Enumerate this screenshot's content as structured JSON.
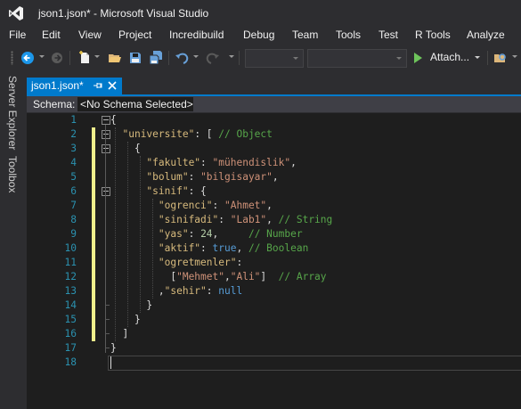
{
  "window": {
    "title": "json1.json* - Microsoft Visual Studio"
  },
  "menu": [
    "File",
    "Edit",
    "View",
    "Project",
    "Incredibuild",
    "Debug",
    "Team",
    "Tools",
    "Test",
    "R Tools",
    "Analyze"
  ],
  "toolbar": {
    "attach_label": "Attach...",
    "icons": [
      "back-icon",
      "forward-icon",
      "new-project-icon",
      "open-file-icon",
      "save-icon",
      "save-all-icon",
      "undo-icon",
      "redo-icon",
      "start-icon",
      "find-icon"
    ]
  },
  "side_panels": [
    "Server Explorer",
    "Toolbox"
  ],
  "tab": {
    "label": "json1.json*"
  },
  "schema": {
    "label": "Schema:",
    "value": "<No Schema Selected>"
  },
  "editor": {
    "lines": [
      [
        {
          "t": "{",
          "c": "punc"
        }
      ],
      [
        {
          "t": "  ",
          "c": "punc"
        },
        {
          "t": "\"universite\"",
          "c": "key"
        },
        {
          "t": ": [ ",
          "c": "punc"
        },
        {
          "t": "// Object",
          "c": "com"
        }
      ],
      [
        {
          "t": "    {",
          "c": "punc"
        }
      ],
      [
        {
          "t": "      ",
          "c": "punc"
        },
        {
          "t": "\"fakulte\"",
          "c": "key"
        },
        {
          "t": ": ",
          "c": "punc"
        },
        {
          "t": "\"mühendislik\"",
          "c": "str"
        },
        {
          "t": ",",
          "c": "punc"
        }
      ],
      [
        {
          "t": "      ",
          "c": "punc"
        },
        {
          "t": "\"bolum\"",
          "c": "key"
        },
        {
          "t": ": ",
          "c": "punc"
        },
        {
          "t": "\"bilgisayar\"",
          "c": "str"
        },
        {
          "t": ",",
          "c": "punc"
        }
      ],
      [
        {
          "t": "      ",
          "c": "punc"
        },
        {
          "t": "\"sinif\"",
          "c": "key"
        },
        {
          "t": ": {",
          "c": "punc"
        }
      ],
      [
        {
          "t": "        ",
          "c": "punc"
        },
        {
          "t": "\"ogrenci\"",
          "c": "key"
        },
        {
          "t": ": ",
          "c": "punc"
        },
        {
          "t": "\"Ahmet\"",
          "c": "str"
        },
        {
          "t": ",",
          "c": "punc"
        }
      ],
      [
        {
          "t": "        ",
          "c": "punc"
        },
        {
          "t": "\"sinifadi\"",
          "c": "key"
        },
        {
          "t": ": ",
          "c": "punc"
        },
        {
          "t": "\"Lab1\"",
          "c": "str"
        },
        {
          "t": ", ",
          "c": "punc"
        },
        {
          "t": "// String",
          "c": "com"
        }
      ],
      [
        {
          "t": "        ",
          "c": "punc"
        },
        {
          "t": "\"yas\"",
          "c": "key"
        },
        {
          "t": ": ",
          "c": "punc"
        },
        {
          "t": "24",
          "c": "num"
        },
        {
          "t": ",     ",
          "c": "punc"
        },
        {
          "t": "// Number",
          "c": "com"
        }
      ],
      [
        {
          "t": "        ",
          "c": "punc"
        },
        {
          "t": "\"aktif\"",
          "c": "key"
        },
        {
          "t": ": ",
          "c": "punc"
        },
        {
          "t": "true",
          "c": "kw"
        },
        {
          "t": ", ",
          "c": "punc"
        },
        {
          "t": "// Boolean",
          "c": "com"
        }
      ],
      [
        {
          "t": "        ",
          "c": "punc"
        },
        {
          "t": "\"ogretmenler\"",
          "c": "key"
        },
        {
          "t": ":",
          "c": "punc"
        }
      ],
      [
        {
          "t": "          [",
          "c": "punc"
        },
        {
          "t": "\"Mehmet\"",
          "c": "str"
        },
        {
          "t": ",",
          "c": "punc"
        },
        {
          "t": "\"Ali\"",
          "c": "str"
        },
        {
          "t": "]  ",
          "c": "punc"
        },
        {
          "t": "// Array",
          "c": "com"
        }
      ],
      [
        {
          "t": "        ,",
          "c": "punc"
        },
        {
          "t": "\"sehir\"",
          "c": "key"
        },
        {
          "t": ": ",
          "c": "punc"
        },
        {
          "t": "null",
          "c": "kw"
        }
      ],
      [
        {
          "t": "      }",
          "c": "punc"
        }
      ],
      [
        {
          "t": "    }",
          "c": "punc"
        }
      ],
      [
        {
          "t": "  ]",
          "c": "punc"
        }
      ],
      [
        {
          "t": "}",
          "c": "punc"
        }
      ],
      []
    ]
  }
}
